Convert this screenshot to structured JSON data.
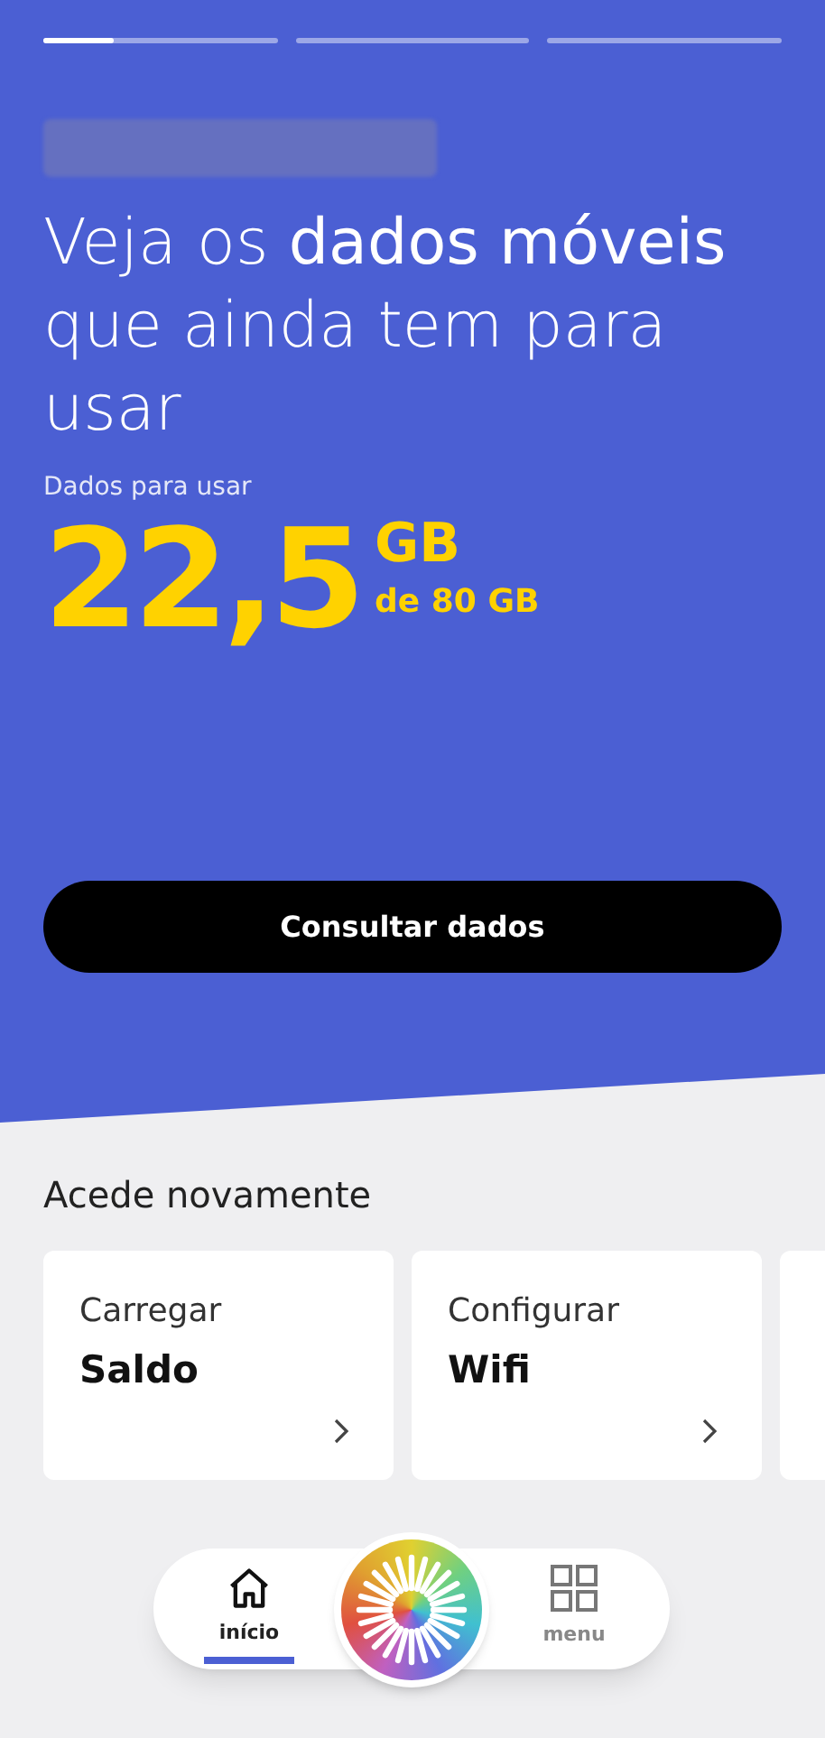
{
  "stories": [
    {
      "level": 0.3
    },
    {
      "level": 0
    },
    {
      "level": 0
    }
  ],
  "headline": "Veja os **dados móveis** que ainda tem para usar",
  "data_label": "Dados para usar",
  "data_amount": "22,5",
  "data_unit": "GB",
  "data_total": "de 80 GB",
  "primary_button": "Consultar dados",
  "section_title": "Acede novamente",
  "shortcuts": [
    {
      "action": "Carregar",
      "target": "Saldo"
    },
    {
      "action": "Configurar",
      "target": "Wifi"
    }
  ],
  "nav": [
    {
      "kind": "home",
      "label": "início",
      "selected": true
    },
    {
      "kind": "center"
    },
    {
      "kind": "menu",
      "label": "menu",
      "selected": false
    }
  ]
}
